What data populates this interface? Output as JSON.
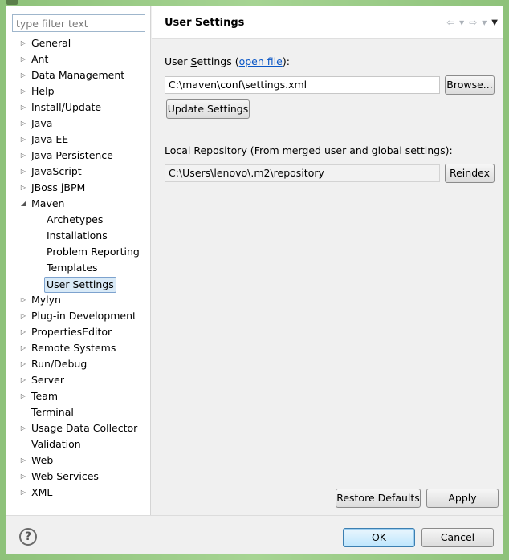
{
  "filter": {
    "placeholder": "type filter text"
  },
  "tree": [
    {
      "label": "General",
      "arrow": "▷"
    },
    {
      "label": "Ant",
      "arrow": "▷"
    },
    {
      "label": "Data Management",
      "arrow": "▷"
    },
    {
      "label": "Help",
      "arrow": "▷"
    },
    {
      "label": "Install/Update",
      "arrow": "▷"
    },
    {
      "label": "Java",
      "arrow": "▷"
    },
    {
      "label": "Java EE",
      "arrow": "▷"
    },
    {
      "label": "Java Persistence",
      "arrow": "▷"
    },
    {
      "label": "JavaScript",
      "arrow": "▷"
    },
    {
      "label": "JBoss jBPM",
      "arrow": "▷"
    },
    {
      "label": "Maven",
      "arrow": "◢"
    },
    {
      "label": "Archetypes",
      "child": true
    },
    {
      "label": "Installations",
      "child": true
    },
    {
      "label": "Problem Reporting",
      "child": true
    },
    {
      "label": "Templates",
      "child": true
    },
    {
      "label": "User Settings",
      "child": true,
      "selected": true
    },
    {
      "label": "Mylyn",
      "arrow": "▷"
    },
    {
      "label": "Plug-in Development",
      "arrow": "▷"
    },
    {
      "label": "PropertiesEditor",
      "arrow": "▷"
    },
    {
      "label": "Remote Systems",
      "arrow": "▷"
    },
    {
      "label": "Run/Debug",
      "arrow": "▷"
    },
    {
      "label": "Server",
      "arrow": "▷"
    },
    {
      "label": "Team",
      "arrow": "▷"
    },
    {
      "label": "Terminal"
    },
    {
      "label": "Usage Data Collector",
      "arrow": "▷"
    },
    {
      "label": "Validation"
    },
    {
      "label": "Web",
      "arrow": "▷"
    },
    {
      "label": "Web Services",
      "arrow": "▷"
    },
    {
      "label": "XML",
      "arrow": "▷"
    }
  ],
  "header": {
    "title": "User Settings",
    "back_icon": "⇦",
    "forward_icon": "⇨",
    "dropdown_icon": "▾",
    "menu_icon": "▼"
  },
  "user_settings": {
    "label_prefix": "User ",
    "label_underlined": "S",
    "label_rest": "ettings (",
    "link": "open file",
    "label_suffix": "):",
    "path": "C:\\maven\\conf\\settings.xml",
    "browse": "Browse...",
    "update": "Update Settings"
  },
  "local_repo": {
    "label": "Local Repository (From merged user and global settings):",
    "path": "C:\\Users\\lenovo\\.m2\\repository",
    "reindex": "Reindex"
  },
  "buttons": {
    "restore": "Restore Defaults",
    "apply": "Apply",
    "ok": "OK",
    "cancel": "Cancel"
  },
  "help_icon": "?"
}
